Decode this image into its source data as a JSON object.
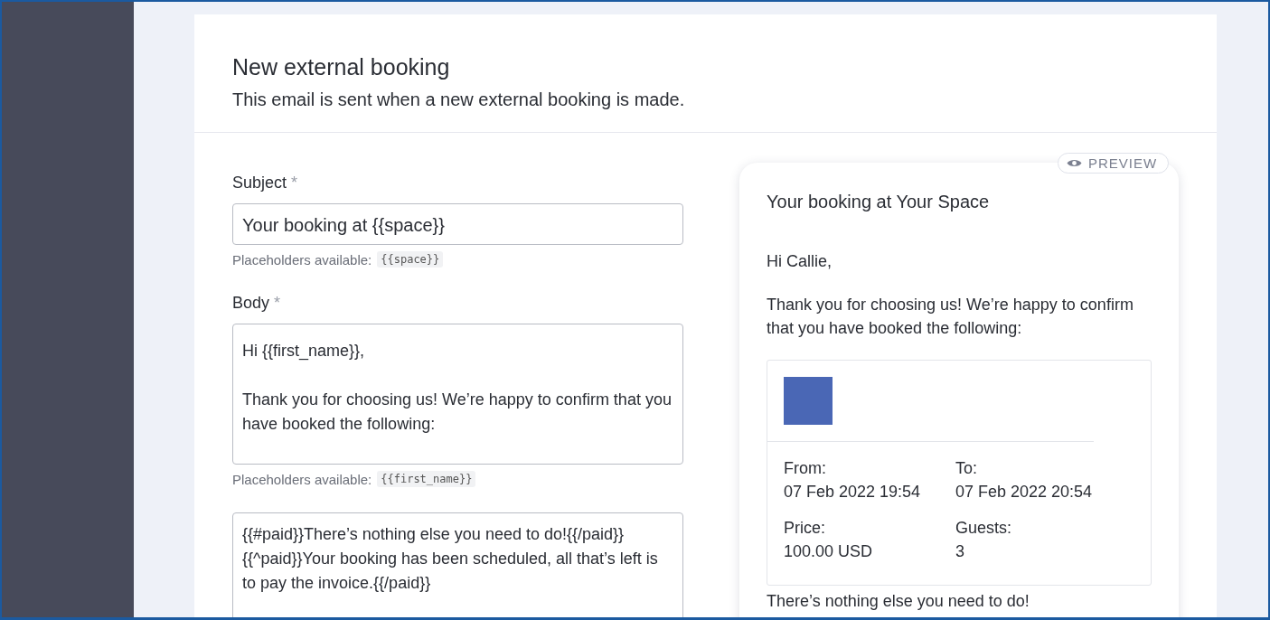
{
  "header": {
    "title": "New external booking",
    "subtitle": "This email is sent when a new external booking is made."
  },
  "form": {
    "fields": [
      {
        "label": "Subject",
        "required_mark": "*",
        "kind": "input",
        "value": "Your booking at {{space}}",
        "hint": "Placeholders available:",
        "placeholders": [
          "{{space}}"
        ]
      },
      {
        "label": "Body",
        "required_mark": "*",
        "kind": "textarea",
        "value": "Hi {{first_name}},\n\nThank you for choosing us! We’re happy to confirm that you have booked the following:",
        "hint": "Placeholders available:",
        "placeholders": [
          "{{first_name}}"
        ]
      },
      {
        "kind": "textarea",
        "value": "{{#paid}}There’s nothing else you need to do!{{/paid}}\n{{^paid}}Your booking has been scheduled, all that’s left is to pay the invoice.{{/paid}}"
      }
    ]
  },
  "preview": {
    "badge": "PREVIEW",
    "subject": "Your booking at Your Space",
    "greeting": "Hi Callie,",
    "intro": "Thank you for choosing us! We’re happy to confirm that you have booked the following:",
    "booking": {
      "fields": [
        {
          "label": "From:",
          "value": "07 Feb 2022 19:54"
        },
        {
          "label": "To:",
          "value": "07 Feb 2022 20:54"
        },
        {
          "label": "Price:",
          "value": "100.00 USD"
        },
        {
          "label": "Guests:",
          "value": "3"
        }
      ]
    },
    "closing": "There’s nothing else you need to do!"
  }
}
